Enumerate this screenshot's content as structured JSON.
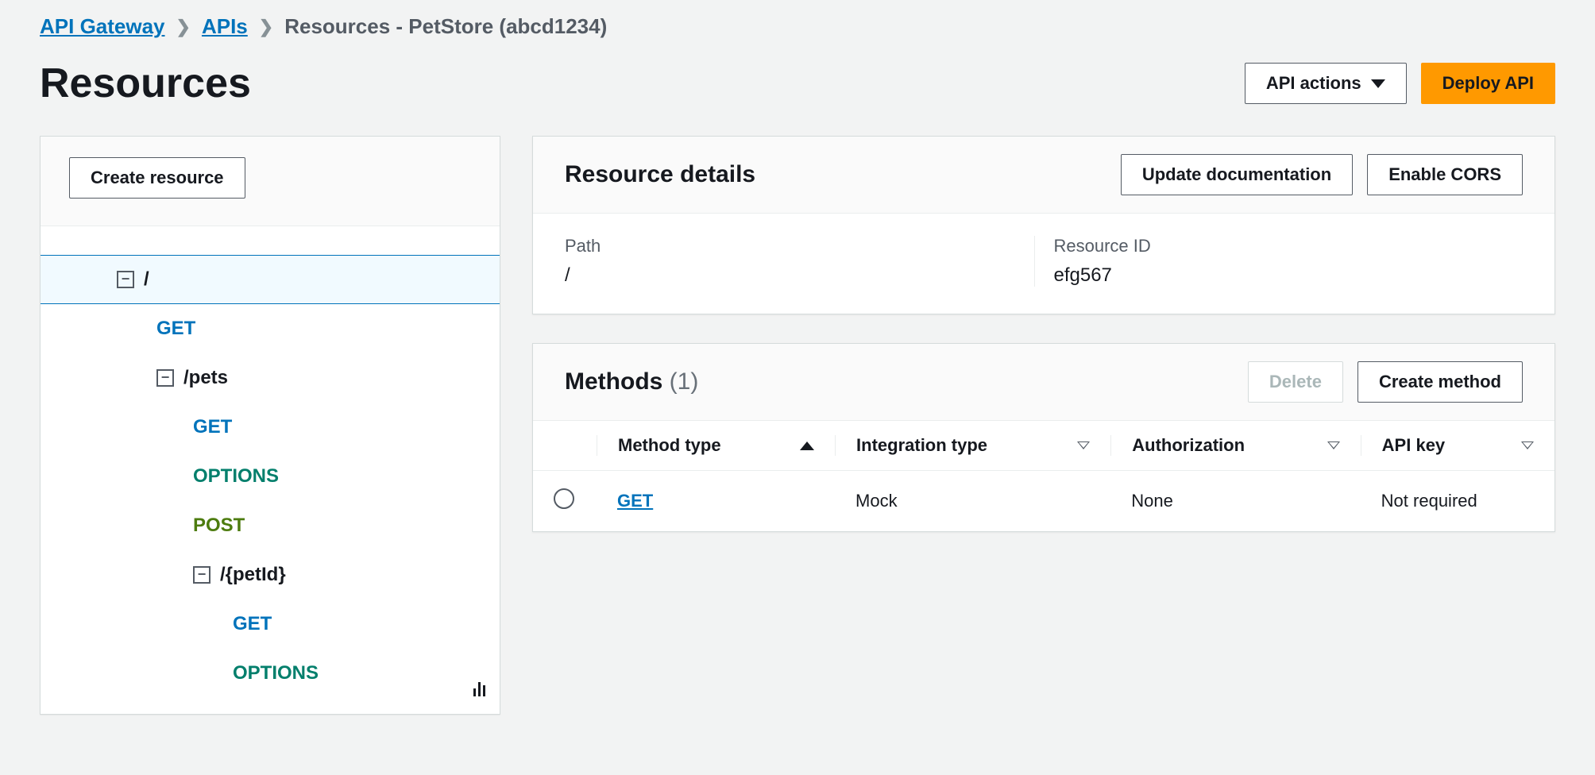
{
  "breadcrumb": {
    "items": [
      "API Gateway",
      "APIs",
      "Resources - PetStore (abcd1234)"
    ]
  },
  "page": {
    "title": "Resources",
    "api_actions_label": "API actions",
    "deploy_label": "Deploy API"
  },
  "sidebar": {
    "create_label": "Create resource",
    "tree": [
      {
        "label": "/",
        "kind": "path",
        "indent": 0,
        "hasToggle": true,
        "selected": true
      },
      {
        "label": "GET",
        "kind": "m-get",
        "indent": 1,
        "hasToggle": false
      },
      {
        "label": "/pets",
        "kind": "path",
        "indent": 1,
        "hasToggle": true
      },
      {
        "label": "GET",
        "kind": "m-get",
        "indent": 2,
        "hasToggle": false
      },
      {
        "label": "OPTIONS",
        "kind": "m-options",
        "indent": 2,
        "hasToggle": false
      },
      {
        "label": "POST",
        "kind": "m-post",
        "indent": 2,
        "hasToggle": false
      },
      {
        "label": "/{petId}",
        "kind": "path",
        "indent": 2,
        "hasToggle": true
      },
      {
        "label": "GET",
        "kind": "m-get",
        "indent": 3,
        "hasToggle": false
      },
      {
        "label": "OPTIONS",
        "kind": "m-options",
        "indent": 3,
        "hasToggle": false
      }
    ]
  },
  "details": {
    "title": "Resource details",
    "update_doc_label": "Update documentation",
    "enable_cors_label": "Enable CORS",
    "path_label": "Path",
    "path_value": "/",
    "resource_id_label": "Resource ID",
    "resource_id_value": "efg567"
  },
  "methods": {
    "title": "Methods",
    "count": "(1)",
    "delete_label": "Delete",
    "create_label": "Create method",
    "columns": {
      "method_type": "Method type",
      "integration_type": "Integration type",
      "authorization": "Authorization",
      "api_key": "API key"
    },
    "rows": [
      {
        "method": "GET",
        "integration": "Mock",
        "authorization": "None",
        "api_key": "Not required"
      }
    ]
  }
}
